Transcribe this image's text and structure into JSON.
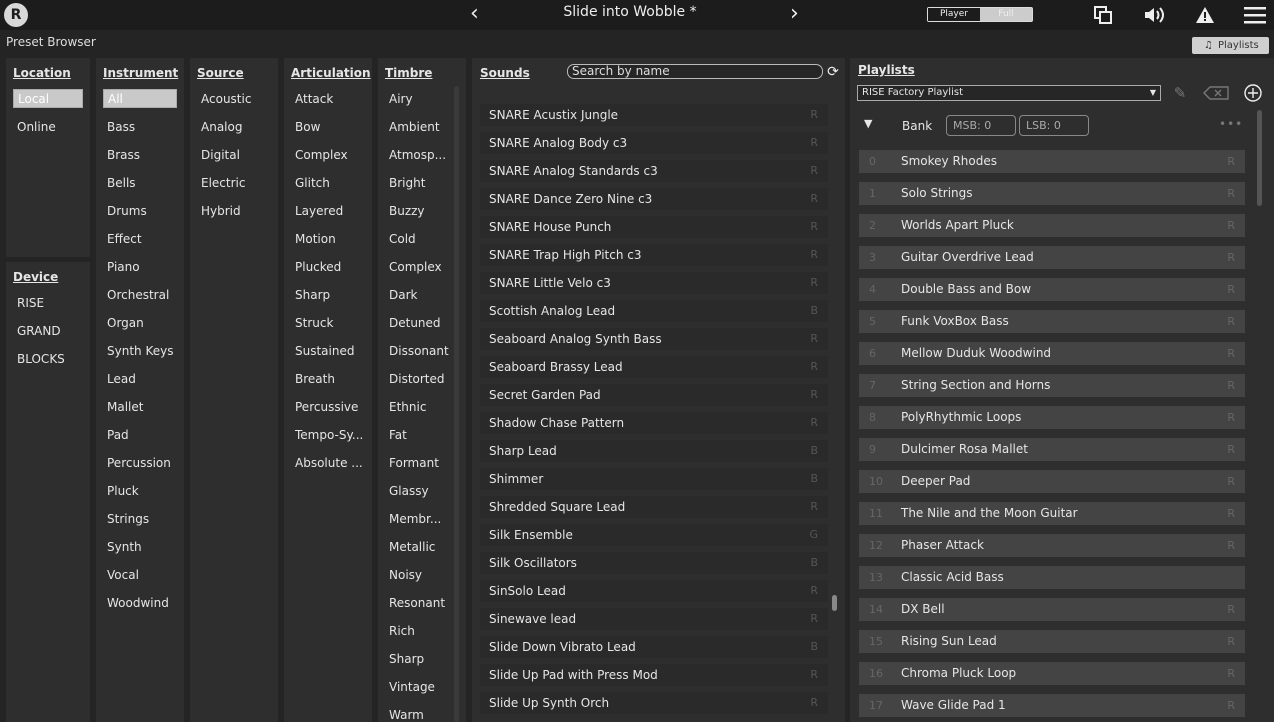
{
  "app": {
    "title": "Slide into Wobble *",
    "logo": "R",
    "section_title": "Preset Browser",
    "playlists_button": "Playlists"
  },
  "mode": {
    "player": "Player",
    "full": "Full"
  },
  "icons": [
    "prev-arrow-icon",
    "next-arrow-icon",
    "window-icon",
    "speaker-icon",
    "warning-icon",
    "menu-icon"
  ],
  "location": {
    "header": "Location",
    "items": [
      "Local",
      "Online"
    ],
    "selected": "Local"
  },
  "device": {
    "header": "Device",
    "items": [
      "RISE",
      "GRAND",
      "BLOCKS"
    ]
  },
  "instrument": {
    "header": "Instrument",
    "items": [
      "All",
      "Bass",
      "Brass",
      "Bells",
      "Drums",
      "Effect",
      "Piano",
      "Orchestral",
      "Organ",
      "Synth Keys",
      "Lead",
      "Mallet",
      "Pad",
      "Percussion",
      "Pluck",
      "Strings",
      "Synth",
      "Vocal",
      "Woodwind"
    ]
  },
  "source": {
    "header": "Source",
    "items": [
      "Acoustic",
      "Analog",
      "Digital",
      "Electric",
      "Hybrid"
    ]
  },
  "articulation": {
    "header": "Articulation",
    "items": [
      "Attack",
      "Bow",
      "Complex",
      "Glitch",
      "Layered",
      "Motion",
      "Plucked",
      "Sharp",
      "Struck",
      "Sustained",
      "Breath",
      "Percussive",
      "Tempo-Sy...",
      "Absolute ..."
    ]
  },
  "timbre": {
    "header": "Timbre",
    "items": [
      "Airy",
      "Ambient",
      "Atmosp...",
      "Bright",
      "Buzzy",
      "Cold",
      "Complex",
      "Dark",
      "Detuned",
      "Dissonant",
      "Distorted",
      "Ethnic",
      "Fat",
      "Formant",
      "Glassy",
      "Membr...",
      "Metallic",
      "Noisy",
      "Resonant",
      "Rich",
      "Sharp",
      "Vintage",
      "Warm"
    ]
  },
  "sounds": {
    "header": "Sounds",
    "search_placeholder": "Search by name",
    "rows": [
      {
        "name": "SNARE  Acustix Jungle",
        "tag": "R"
      },
      {
        "name": "SNARE  Analog Body  c3",
        "tag": "R"
      },
      {
        "name": "SNARE  Analog Standards  c3",
        "tag": "R"
      },
      {
        "name": "SNARE  Dance Zero Nine  c3",
        "tag": "R"
      },
      {
        "name": "SNARE  House Punch",
        "tag": "R"
      },
      {
        "name": "SNARE  Trap High Pitch  c3",
        "tag": "R"
      },
      {
        "name": "SNARE Little Velo c3",
        "tag": "R"
      },
      {
        "name": "Scottish Analog Lead",
        "tag": "B"
      },
      {
        "name": "Seaboard Analog Synth Bass",
        "tag": "R"
      },
      {
        "name": "Seaboard Brassy Lead",
        "tag": "R"
      },
      {
        "name": "Secret Garden Pad",
        "tag": "R"
      },
      {
        "name": "Shadow Chase Pattern",
        "tag": "R"
      },
      {
        "name": "Sharp Lead",
        "tag": "B"
      },
      {
        "name": "Shimmer",
        "tag": "B"
      },
      {
        "name": "Shredded Square Lead",
        "tag": "R"
      },
      {
        "name": "Silk Ensemble",
        "tag": "G"
      },
      {
        "name": "Silk Oscillators",
        "tag": "B"
      },
      {
        "name": "SinSolo Lead",
        "tag": "R"
      },
      {
        "name": "Sinewave lead",
        "tag": "R"
      },
      {
        "name": "Slide Down Vibrato Lead",
        "tag": "B"
      },
      {
        "name": "Slide Up Pad with Press Mod",
        "tag": "R"
      },
      {
        "name": "Slide Up Synth Orch",
        "tag": "R"
      }
    ]
  },
  "playlists": {
    "header": "Playlists",
    "selected": "RISE Factory Playlist",
    "bank_label": "Bank",
    "msb": "MSB: 0",
    "lsb": "LSB: 0",
    "rows": [
      {
        "num": "0",
        "name": "Smokey Rhodes",
        "tag": "R"
      },
      {
        "num": "1",
        "name": "Solo Strings",
        "tag": "R"
      },
      {
        "num": "2",
        "name": "Worlds Apart Pluck",
        "tag": "R"
      },
      {
        "num": "3",
        "name": "Guitar Overdrive Lead",
        "tag": "R"
      },
      {
        "num": "4",
        "name": "Double Bass and Bow",
        "tag": "R"
      },
      {
        "num": "5",
        "name": "Funk VoxBox Bass",
        "tag": "R"
      },
      {
        "num": "6",
        "name": "Mellow Duduk Woodwind",
        "tag": "R"
      },
      {
        "num": "7",
        "name": "String Section and Horns",
        "tag": "R"
      },
      {
        "num": "8",
        "name": "PolyRhythmic Loops",
        "tag": "R"
      },
      {
        "num": "9",
        "name": "Dulcimer Rosa Mallet",
        "tag": "R"
      },
      {
        "num": "10",
        "name": "Deeper Pad",
        "tag": "R"
      },
      {
        "num": "11",
        "name": "The Nile and the Moon Guitar",
        "tag": "R"
      },
      {
        "num": "12",
        "name": "Phaser Attack",
        "tag": "R"
      },
      {
        "num": "13",
        "name": "Classic Acid Bass",
        "tag": ""
      },
      {
        "num": "14",
        "name": "DX Bell",
        "tag": "R"
      },
      {
        "num": "15",
        "name": "Rising Sun Lead",
        "tag": "R"
      },
      {
        "num": "16",
        "name": "Chroma Pluck Loop",
        "tag": "R"
      },
      {
        "num": "17",
        "name": "Wave Glide Pad 1",
        "tag": "R"
      }
    ]
  }
}
